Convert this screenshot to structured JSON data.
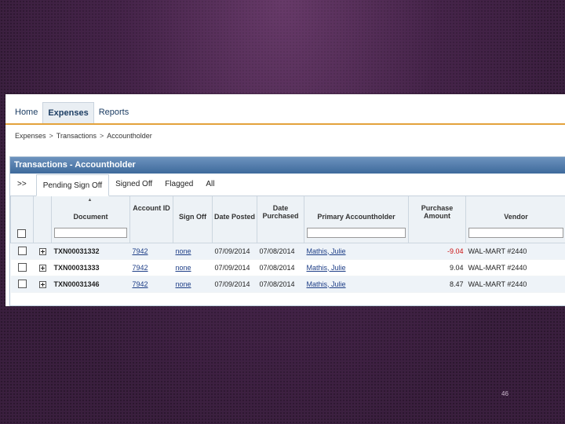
{
  "nav": {
    "items": [
      "Home",
      "Expenses",
      "Reports"
    ],
    "active": 1
  },
  "breadcrumb": [
    "Expenses",
    "Transactions",
    "Accountholder"
  ],
  "breadcrumb_sep": ">",
  "panel": {
    "title": "Transactions - Accountholder"
  },
  "tabs": [
    ">>",
    "Pending Sign Off",
    "Signed Off",
    "Flagged",
    "All"
  ],
  "tabs_active": 1,
  "table": {
    "headers": {
      "document": "Document",
      "account_id": "Account ID",
      "sign_off": "Sign Off",
      "date_posted": "Date Posted",
      "date_purchased": "Date Purchased",
      "primary_accountholder": "Primary Accountholder",
      "purchase_amount": "Purchase Amount",
      "vendor": "Vendor"
    },
    "rows": [
      {
        "document": "TXN00031332",
        "account_id": "7942",
        "sign_off": "none",
        "date_posted": "07/09/2014",
        "date_purchased": "07/08/2014",
        "accountholder": "Mathis, Julie",
        "amount": "-9.04",
        "vendor": "WAL-MART #2440"
      },
      {
        "document": "TXN00031333",
        "account_id": "7942",
        "sign_off": "none",
        "date_posted": "07/09/2014",
        "date_purchased": "07/08/2014",
        "accountholder": "Mathis, Julie",
        "amount": "9.04",
        "vendor": "WAL-MART #2440"
      },
      {
        "document": "TXN00031346",
        "account_id": "7942",
        "sign_off": "none",
        "date_posted": "07/09/2014",
        "date_purchased": "07/08/2014",
        "accountholder": "Mathis, Julie",
        "amount": "8.47",
        "vendor": "WAL-MART #2440"
      }
    ]
  },
  "colors": {
    "negative_amount": "#cc1111",
    "link": "#1c3d86",
    "header_bar": "#4f7aaa",
    "nav_accent": "#e3a23b"
  },
  "icons": {
    "sort": "sort-asc-icon",
    "expand": "plus-box-icon"
  },
  "slide_number": "46"
}
